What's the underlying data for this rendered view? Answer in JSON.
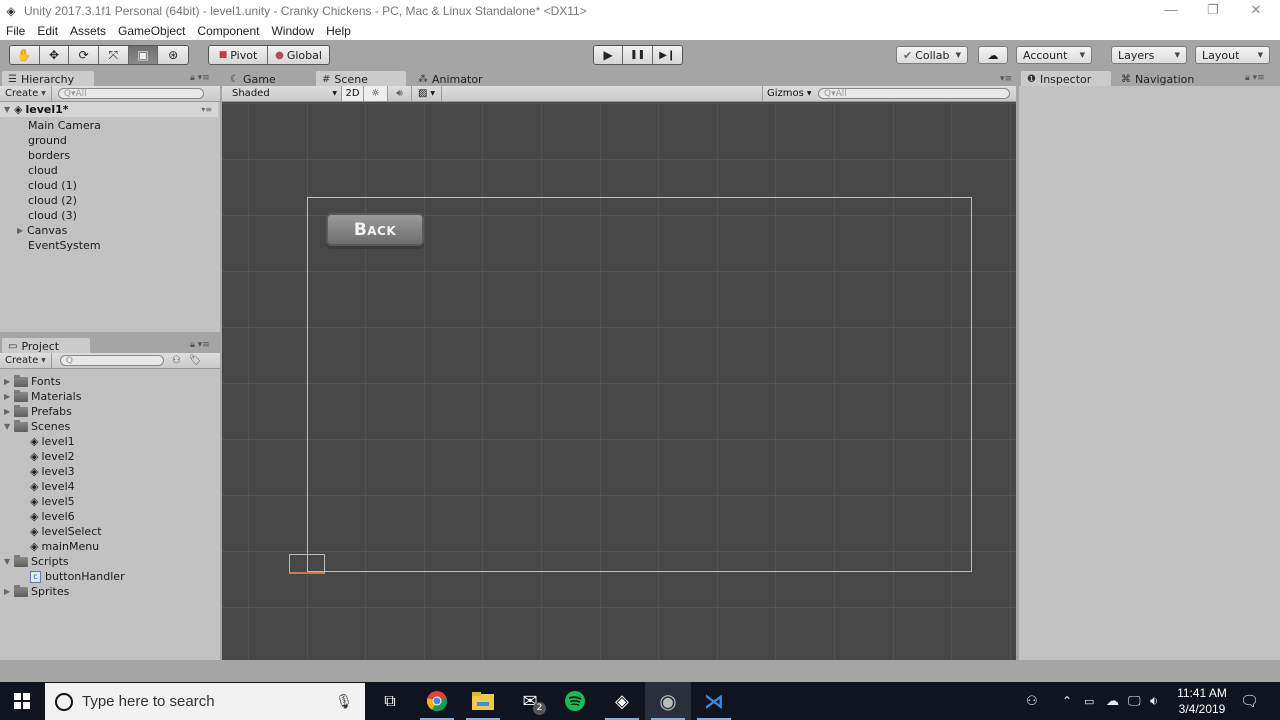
{
  "window": {
    "title": "Unity 2017.3.1f1 Personal (64bit) - level1.unity - Cranky Chickens - PC, Mac & Linux Standalone* <DX11>",
    "controls": {
      "minimize": "—",
      "restore": "❐",
      "close": "✕"
    }
  },
  "menu": [
    "File",
    "Edit",
    "Assets",
    "GameObject",
    "Component",
    "Window",
    "Help"
  ],
  "toolbar": {
    "transform_tools": [
      {
        "name": "hand",
        "glyph": "✋"
      },
      {
        "name": "move",
        "glyph": "✥"
      },
      {
        "name": "rotate",
        "glyph": "⟳"
      },
      {
        "name": "scale",
        "glyph": "⤧"
      },
      {
        "name": "rect",
        "glyph": "▣",
        "active": true
      },
      {
        "name": "transform",
        "glyph": "⊛"
      }
    ],
    "pivot_label": "Pivot",
    "global_label": "Global",
    "play": "▶",
    "pause": "❚❚",
    "step": "▶❙",
    "collab_label": "Collab",
    "cloud_glyph": "☁",
    "account_label": "Account",
    "layers_label": "Layers",
    "layout_label": "Layout"
  },
  "hierarchy": {
    "tab_label": "Hierarchy",
    "create_label": "Create",
    "search_placeholder": "Q▾All",
    "scene_name": "level1*",
    "items": [
      {
        "label": "Main Camera",
        "expandable": false
      },
      {
        "label": "ground",
        "expandable": false
      },
      {
        "label": "borders",
        "expandable": false
      },
      {
        "label": "cloud",
        "expandable": false
      },
      {
        "label": "cloud (1)",
        "expandable": false
      },
      {
        "label": "cloud (2)",
        "expandable": false
      },
      {
        "label": "cloud (3)",
        "expandable": false
      },
      {
        "label": "Canvas",
        "expandable": true
      },
      {
        "label": "EventSystem",
        "expandable": false
      }
    ]
  },
  "scene_tabs": {
    "game_label": "Game",
    "scene_label": "Scene",
    "animator_label": "Animator",
    "shading_mode": "Shaded",
    "mode_2d": "2D",
    "gizmos_label": "Gizmos",
    "search_placeholder": "Q▾All"
  },
  "scene": {
    "back_button_label": "Back"
  },
  "project": {
    "tab_label": "Project",
    "create_label": "Create",
    "search_placeholder": "Q",
    "tree": [
      {
        "label": "Fonts",
        "type": "folder",
        "expanded": false,
        "depth": 0
      },
      {
        "label": "Materials",
        "type": "folder",
        "expanded": false,
        "depth": 0
      },
      {
        "label": "Prefabs",
        "type": "folder",
        "expanded": false,
        "depth": 0
      },
      {
        "label": "Scenes",
        "type": "folder",
        "expanded": true,
        "depth": 0
      },
      {
        "label": "level1",
        "type": "scene",
        "depth": 1
      },
      {
        "label": "level2",
        "type": "scene",
        "depth": 1
      },
      {
        "label": "level3",
        "type": "scene",
        "depth": 1
      },
      {
        "label": "level4",
        "type": "scene",
        "depth": 1
      },
      {
        "label": "level5",
        "type": "scene",
        "depth": 1
      },
      {
        "label": "level6",
        "type": "scene",
        "depth": 1
      },
      {
        "label": "levelSelect",
        "type": "scene",
        "depth": 1
      },
      {
        "label": "mainMenu",
        "type": "scene",
        "depth": 1
      },
      {
        "label": "Scripts",
        "type": "folder",
        "expanded": true,
        "depth": 0
      },
      {
        "label": "buttonHandler",
        "type": "script",
        "depth": 1
      },
      {
        "label": "Sprites",
        "type": "folder",
        "expanded": false,
        "depth": 0
      }
    ]
  },
  "inspector": {
    "inspector_label": "Inspector",
    "navigation_label": "Navigation"
  },
  "taskbar": {
    "search_placeholder": "Type here to search",
    "apps": [
      {
        "name": "task-view",
        "glyph": "⧉"
      },
      {
        "name": "chrome",
        "glyph": "●",
        "color": "#4a8be8"
      },
      {
        "name": "file-explorer",
        "glyph": "▬",
        "color": "#f2c94c"
      },
      {
        "name": "mail",
        "glyph": "✉",
        "badge": "2"
      },
      {
        "name": "spotify",
        "glyph": "●",
        "color": "#1db954"
      },
      {
        "name": "unity",
        "glyph": "◈"
      },
      {
        "name": "obs",
        "glyph": "◉"
      },
      {
        "name": "visual-studio",
        "glyph": "⋊",
        "color": "#3b8be0"
      }
    ],
    "time": "11:41 AM",
    "date": "3/4/2019"
  }
}
